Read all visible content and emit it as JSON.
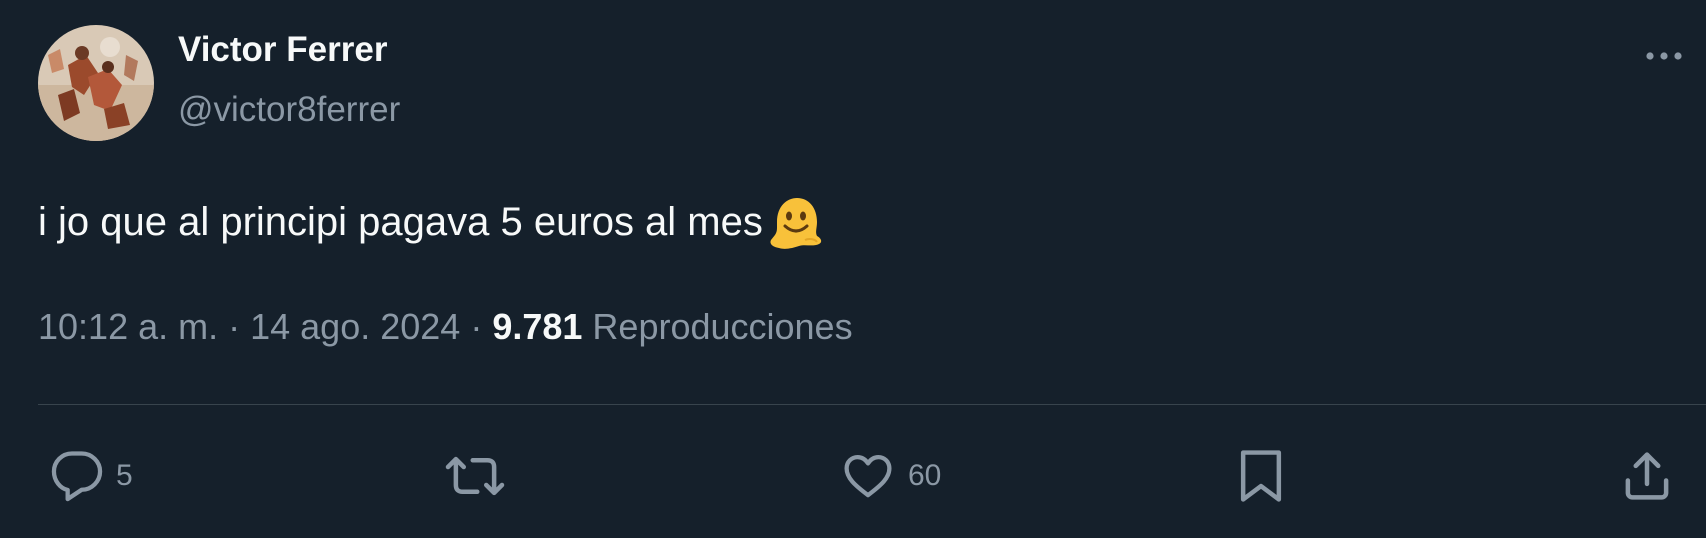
{
  "author": {
    "display_name": "Victor Ferrer",
    "handle": "@victor8ferrer"
  },
  "tweet": {
    "text": "i jo que al principi pagava 5 euros al mes",
    "emoji": "melting-face-emoji"
  },
  "meta": {
    "time": "10:12 a. m.",
    "separator": "·",
    "date": "14 ago. 2024",
    "views_count": "9.781",
    "views_label": "Reproducciones"
  },
  "actions": {
    "reply_count": "5",
    "like_count": "60"
  },
  "icons": {
    "more": "more-horizontal-icon",
    "reply": "reply-icon",
    "retweet": "retweet-icon",
    "like": "heart-icon",
    "bookmark": "bookmark-icon",
    "share": "share-icon"
  },
  "colors": {
    "background": "#15202b",
    "text_primary": "#f7f9f9",
    "text_secondary": "#8b98a5",
    "divider": "#38444d"
  }
}
